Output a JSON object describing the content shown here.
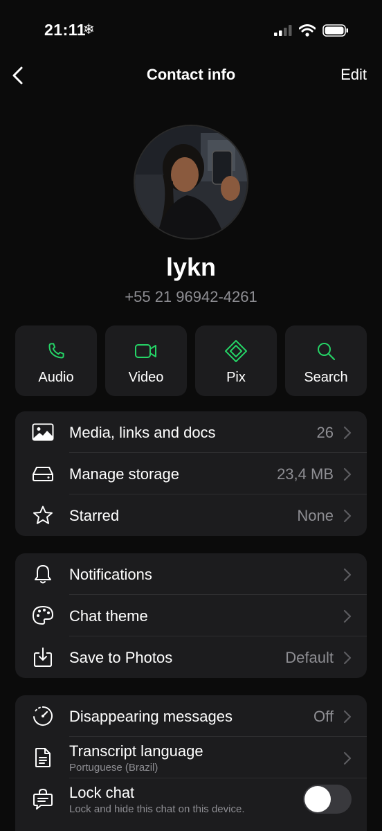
{
  "status": {
    "time": "21:11",
    "weather_icon": "snowflake-icon"
  },
  "nav": {
    "title": "Contact info",
    "edit_label": "Edit",
    "back_icon": "chevron-left-icon"
  },
  "profile": {
    "name": "lykn",
    "phone": "+55 21 96942-4261"
  },
  "actions": [
    {
      "label": "Audio",
      "icon": "phone-icon"
    },
    {
      "label": "Video",
      "icon": "video-camera-icon"
    },
    {
      "label": "Pix",
      "icon": "pix-icon"
    },
    {
      "label": "Search",
      "icon": "search-icon"
    }
  ],
  "group1": [
    {
      "label": "Media, links and docs",
      "value": "26",
      "icon": "photo-icon"
    },
    {
      "label": "Manage storage",
      "value": "23,4 MB",
      "icon": "storage-icon"
    },
    {
      "label": "Starred",
      "value": "None",
      "icon": "star-icon"
    }
  ],
  "group2": [
    {
      "label": "Notifications",
      "value": "",
      "icon": "bell-icon"
    },
    {
      "label": "Chat theme",
      "value": "",
      "icon": "palette-icon"
    },
    {
      "label": "Save to Photos",
      "value": "Default",
      "icon": "save-download-icon"
    }
  ],
  "group3": [
    {
      "label": "Disappearing messages",
      "value": "Off",
      "icon": "timer-icon"
    },
    {
      "label": "Transcript language",
      "sublabel": "Portuguese (Brazil)",
      "icon": "document-icon"
    },
    {
      "label": "Lock chat",
      "sublabel": "Lock and hide this chat on this device.",
      "icon": "lock-chat-icon",
      "toggle_on": false
    }
  ],
  "colors": {
    "accent": "#25d366",
    "background": "#0b0b0b",
    "card": "#1c1c1e",
    "secondary_text": "#8e8e93"
  }
}
